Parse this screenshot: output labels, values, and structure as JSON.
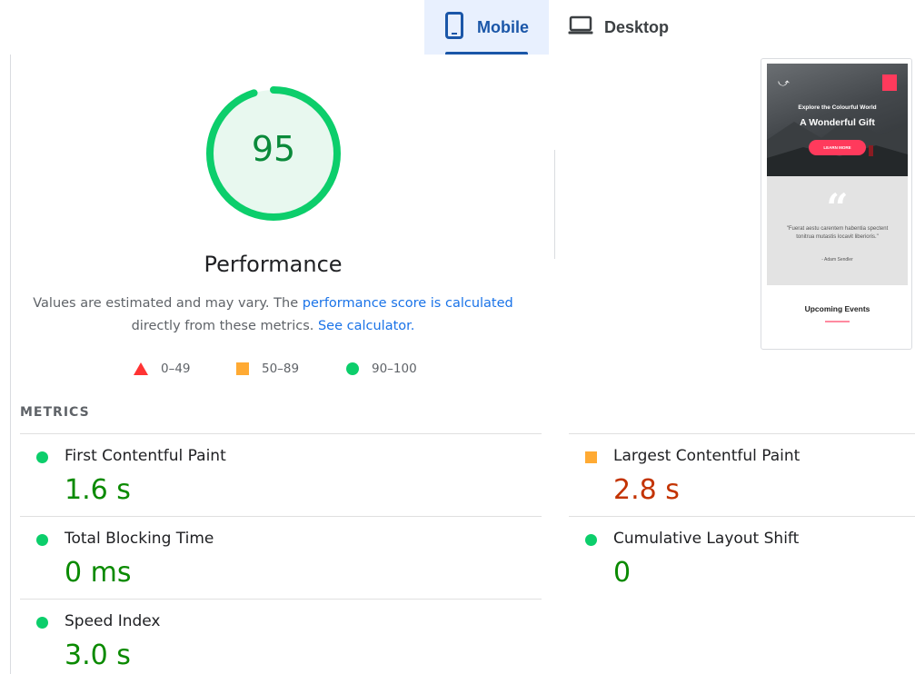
{
  "tabs": [
    {
      "label": "Mobile",
      "active": true,
      "icon": "smartphone-icon"
    },
    {
      "label": "Desktop",
      "active": false,
      "icon": "laptop-icon"
    }
  ],
  "gauge": {
    "score": "95",
    "score_value": 95,
    "title": "Performance",
    "color": "#0cce6b"
  },
  "description": {
    "prefix": "Values are estimated and may vary. The ",
    "link1": "performance score is calculated",
    "middle": "directly from these metrics.",
    "link2": "See calculator."
  },
  "legend": [
    {
      "shape": "triangle",
      "color": "#ff3333",
      "label": "0–49"
    },
    {
      "shape": "square",
      "color": "#ffaa33",
      "label": "50–89"
    },
    {
      "shape": "circle",
      "color": "#0cce6b",
      "label": "90–100"
    }
  ],
  "metrics_heading": "METRICS",
  "metrics": [
    {
      "name": "First Contentful Paint",
      "value": "1.6 s",
      "rating": "good"
    },
    {
      "name": "Largest Contentful Paint",
      "value": "2.8 s",
      "rating": "average"
    },
    {
      "name": "Total Blocking Time",
      "value": "0 ms",
      "rating": "good"
    },
    {
      "name": "Cumulative Layout Shift",
      "value": "0",
      "rating": "good"
    },
    {
      "name": "Speed Index",
      "value": "3.0 s",
      "rating": "good"
    }
  ],
  "screenshot": {
    "hero_subtitle": "Explore the Colourful World",
    "hero_title": "A Wonderful Gift",
    "hero_button": "LEARN MORE",
    "quote": "\"Fuerat aestu carentem habentia spectent tonitrua mutastis locavit liberioris.\"",
    "quote_author": "- Adam Sendler",
    "events_title": "Upcoming Events"
  }
}
